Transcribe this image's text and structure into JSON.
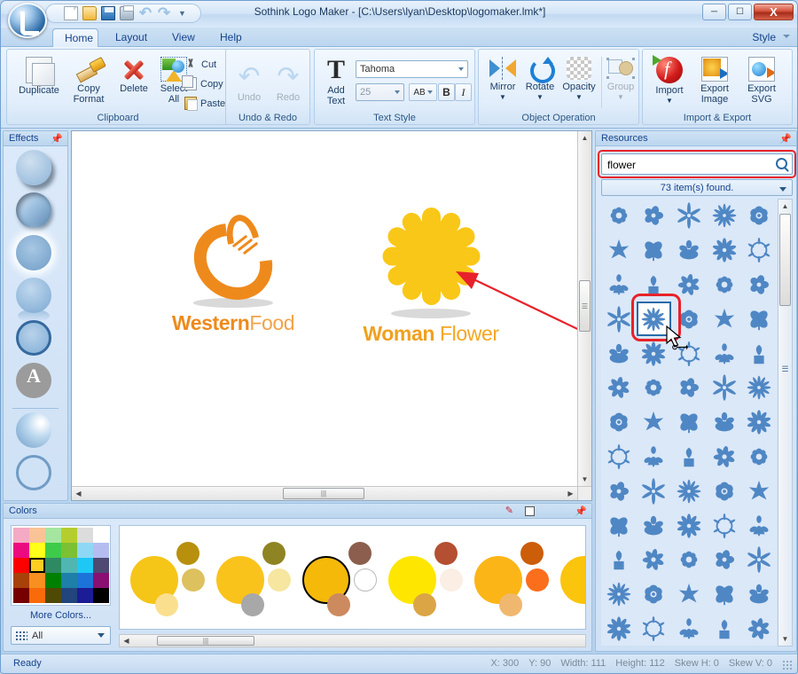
{
  "window": {
    "title": "Sothink Logo Maker - [C:\\Users\\lyan\\Desktop\\logomaker.lmk*]",
    "minimize": "─",
    "maximize": "☐",
    "close": "X"
  },
  "quick_access": [
    {
      "name": "new-document-icon",
      "label": "New"
    },
    {
      "name": "open-folder-icon",
      "label": "Open"
    },
    {
      "name": "save-icon",
      "label": "Save"
    },
    {
      "name": "print-icon",
      "label": "Print"
    },
    {
      "name": "undo-icon",
      "label": "Undo"
    },
    {
      "name": "redo-icon",
      "label": "Redo"
    }
  ],
  "tabs": [
    {
      "label": "Home",
      "active": true
    },
    {
      "label": "Layout",
      "active": false
    },
    {
      "label": "View",
      "active": false
    },
    {
      "label": "Help",
      "active": false
    }
  ],
  "style_menu": "Style",
  "ribbon": {
    "groups": [
      {
        "title": "Clipboard",
        "buttons": [
          {
            "label": "Duplicate",
            "icon": "duplicate-icon"
          },
          {
            "label": "Copy\nFormat",
            "line1": "Copy",
            "line2": "Format",
            "icon": "copy-format-icon"
          },
          {
            "label": "Delete",
            "icon": "delete-icon"
          },
          {
            "label": "Select All",
            "line1": "Select",
            "line2": "All",
            "icon": "select-all-icon"
          }
        ],
        "small_buttons": [
          {
            "label": "Cut",
            "icon": "scissors-icon"
          },
          {
            "label": "Copy",
            "icon": "copy-icon"
          },
          {
            "label": "Paste",
            "icon": "paste-icon"
          }
        ]
      },
      {
        "title": "Undo & Redo",
        "buttons": [
          {
            "label": "Undo",
            "icon": "undo-arrow-icon",
            "disabled": true
          },
          {
            "label": "Redo",
            "icon": "redo-arrow-icon",
            "disabled": true
          }
        ]
      },
      {
        "title": "Text Style",
        "add_text_label": "Add Text",
        "add_text_line1": "Add",
        "add_text_line2": "Text",
        "font_family": "Tahoma",
        "font_size": "25",
        "spacing_label": "AB",
        "bold_label": "B",
        "italic_label": "I"
      },
      {
        "title": "Object Operation",
        "buttons": [
          {
            "label": "Mirror",
            "icon": "mirror-icon"
          },
          {
            "label": "Rotate",
            "icon": "rotate-icon"
          },
          {
            "label": "Opacity",
            "icon": "opacity-icon"
          },
          {
            "label": "Group",
            "icon": "group-icon",
            "disabled": true
          }
        ]
      },
      {
        "title": "Import & Export",
        "buttons": [
          {
            "label": "Import",
            "icon": "flash-import-icon"
          },
          {
            "label": "Export Image",
            "line1": "Export",
            "line2": "Image",
            "icon": "export-image-icon"
          },
          {
            "label": "Export SVG",
            "line1": "Export",
            "line2": "SVG",
            "icon": "export-svg-icon"
          }
        ]
      }
    ]
  },
  "effects_panel": {
    "title": "Effects",
    "pin_icon": "pin-icon",
    "items": [
      {
        "name": "effect-drop-shadow"
      },
      {
        "name": "effect-inner-shadow"
      },
      {
        "name": "effect-glow"
      },
      {
        "name": "effect-reflection"
      },
      {
        "name": "effect-stroke"
      },
      {
        "name": "effect-text-mask"
      },
      {
        "name": "effect-gradient"
      },
      {
        "name": "effect-outline"
      }
    ]
  },
  "canvas": {
    "logos": [
      {
        "name": "western-food-logo",
        "mark": "fork-circle-mark",
        "caption_bold": "Western",
        "caption_light": "Food",
        "color": "#ee8a1c"
      },
      {
        "name": "woman-flower-logo",
        "mark": "daisy-flower-mark",
        "caption_bold": "Woman",
        "caption_light": "Flower",
        "color": "#f5a623",
        "petal_color": "#f9c717"
      }
    ],
    "annotation_arrow": {
      "name": "red-pointer-arrow",
      "color": "#e8222a"
    }
  },
  "colors_panel": {
    "title": "Colors",
    "eyedropper_icon": "eyedropper-icon",
    "current_color": "#ffffff",
    "pin_icon": "pin-icon",
    "more_colors": "More Colors...",
    "filter_value": "All",
    "swatches": [
      "#f4aac4",
      "#f9c396",
      "#a4e6a0",
      "#b5ce2e",
      "#dcdcdc",
      "#ffffff",
      "#ec0a7f",
      "#ffff1a",
      "#3ecb4a",
      "#7cc033",
      "#8fd8f5",
      "#b5bdf0",
      "#fc0000",
      "#ffcc22",
      "#2e8a63",
      "#4fb6b2",
      "#1ec8f5",
      "#4e4a72",
      "#a8400a",
      "#f79020",
      "#008000",
      "#1e7fa8",
      "#1c74d8",
      "#8a0f72",
      "#760000",
      "#f96a0a",
      "#4e4a06",
      "#21457c",
      "#1c1c96",
      "#000000"
    ],
    "selected_swatch_index": 13,
    "palettes": [
      {
        "main": "#f5c518",
        "a": "#b8900e",
        "b": "#ddc15f",
        "c": "#fadf8e",
        "selected": false
      },
      {
        "main": "#fac31c",
        "a": "#8f8423",
        "b": "#f7e6a0",
        "c": "#a8a8a8",
        "selected": false
      },
      {
        "main": "#f5b90a",
        "a": "#8b5e4e",
        "b": "#ffffff",
        "c": "#cc8a5e",
        "selected": true
      },
      {
        "main": "#ffe600",
        "a": "#b44f32",
        "b": "#fbeee4",
        "c": "#dba546",
        "selected": false
      },
      {
        "main": "#fbb516",
        "a": "#cc5d09",
        "b": "#fa6e1c",
        "c": "#f0b86e",
        "selected": false
      },
      {
        "main": "#fbc40d",
        "a": "#d06a10",
        "b": "#f9d36a",
        "c": "#e8a33d",
        "selected": false
      }
    ]
  },
  "resources_panel": {
    "title": "Resources",
    "pin_icon": "pin-icon",
    "search_value": "flower",
    "search_placeholder": "",
    "search_icon": "search-magnifier-icon",
    "result_count_text": "73 item(s) found.",
    "selected_cell_index": 16,
    "cursor_icon": "drag-cursor-icon",
    "grid_columns": 5,
    "icons": [
      "orchid-stem",
      "gear-flower",
      "daffodil",
      "lotus-bud",
      "cog-blossom",
      "asterisk-star",
      "sakura-bloom",
      "star-flower",
      "blob-cloud",
      "four-petal",
      "sun-flower",
      "plumeria",
      "daisy-burst",
      "daisy-outline",
      "starburst-daisy",
      "cloud-swirl",
      "chrysanthemum",
      "grass-tuft",
      "ring-flower",
      "floral-sprig",
      "maple-spray",
      "leaf-blades",
      "trefoil-flower",
      "cherry-blossom",
      "sakura-outline",
      "water-lily",
      "vine-sprig",
      "clover-bloom",
      "pinwheel-flower",
      "star-leaf",
      "narcissus",
      "dandelion",
      "circle-wreath",
      "potted-sprout",
      "bellflower",
      "double-blossom",
      "heart-rose-pot",
      "flower-pot-plant",
      "gift-box-plant",
      "tulip-bud",
      "spiral-rose",
      "square-flower",
      "long-stem-rose",
      "person-flower",
      "shamrock-stem",
      "tulip",
      "small-branch",
      "poppy-stem",
      "rose-outline",
      "snowflake-bloom",
      "dahlia-ball",
      "pointed-petals",
      "frangipani",
      "palm-leaf",
      "monstera-leaf",
      "aloe-bloom",
      "lotus-flat",
      "ornate-star",
      "mandala-ring",
      "swirl-ornament",
      "crown-bloom",
      "thin-grass",
      "chrysanth-bloom",
      "peony-flower",
      "lily-bloom"
    ]
  },
  "status_bar": {
    "ready": "Ready",
    "metrics": [
      "X: 300",
      "Y: 90",
      "Width: 111",
      "Height: 112",
      "Skew H: 0",
      "Skew V: 0"
    ]
  }
}
